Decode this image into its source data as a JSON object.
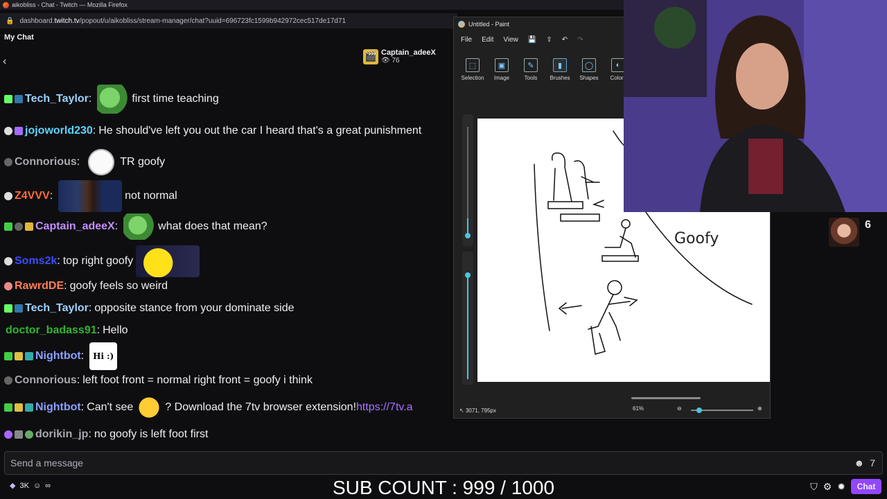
{
  "browser": {
    "title": "aikobliss - Chat - Twitch — Mozilla Firefox",
    "url_prefix": "dashboard.",
    "url_domain": "twitch.tv",
    "url_path": "/popout/u/aikobliss/stream-manager/chat?uuid=696723fc1599b942972cec517de17d71"
  },
  "chat": {
    "header": "My Chat",
    "pinned_user": "Captain_adeeX",
    "pinned_viewers": "76",
    "messages": [
      {
        "user": "Tech_Taylor",
        "color": "#9cd1ff",
        "text": "first time teaching",
        "emote": "pepe"
      },
      {
        "user": "jojoworld230",
        "color": "#5fd4ff",
        "text": "He should've left you out the car I heard that's a great punishment"
      },
      {
        "user": "Connorious",
        "color": "#a8a8b0",
        "text": "TR goofy",
        "emote": "troll"
      },
      {
        "user": "Z4VVV",
        "color": "#ff6a3d",
        "text": "not normal",
        "emote": "face"
      },
      {
        "user": "Captain_adeeX",
        "color": "#c48dff",
        "text": "what does that mean?",
        "emote": "pepe"
      },
      {
        "user": "Soms2k",
        "color": "#3a4dff",
        "text": "top right goofy",
        "emote": "yellow"
      },
      {
        "user": "RawrdDE",
        "color": "#ff7e55",
        "text": "goofy feels so weird"
      },
      {
        "user": "Tech_Taylor",
        "color": "#9cd1ff",
        "text": "opposite stance from your dominate side"
      },
      {
        "user": "doctor_badass91",
        "color": "#2fb52f",
        "text": "Hello"
      },
      {
        "user": "Nightbot",
        "color": "#8aa0ff",
        "text": "Hi :)",
        "emote": "hi"
      },
      {
        "user": "Connorious",
        "color": "#a8a8b0",
        "text": "left foot front = normal right front = goofy i think"
      },
      {
        "user": "Nightbot",
        "color": "#8aa0ff",
        "text": "Can't see",
        "text2": "? Download the 7tv browser extension!",
        "link": "https://7tv.a",
        "emote": "smirk"
      },
      {
        "user": "dorikin_jp",
        "color": "#a8a8b0",
        "text": "no goofy is left foot first"
      }
    ],
    "input_placeholder": "Send a message",
    "points": "3K",
    "sub_count": "SUB COUNT : 999 / 1000",
    "chat_button": "Chat"
  },
  "paint": {
    "title": "Untitled - Paint",
    "menu": [
      "File",
      "Edit",
      "View"
    ],
    "tools": [
      {
        "label": "Selection",
        "icon": "selection-icon",
        "glyph": "⬚"
      },
      {
        "label": "Image",
        "icon": "image-icon",
        "glyph": "▣"
      },
      {
        "label": "Tools",
        "icon": "tools-icon",
        "glyph": "✎"
      },
      {
        "label": "Brushes",
        "icon": "brush-icon",
        "glyph": "▮"
      },
      {
        "label": "Shapes",
        "icon": "shapes-icon",
        "glyph": "◯"
      },
      {
        "label": "Colors",
        "icon": "colors-icon",
        "glyph": "◐"
      }
    ],
    "canvas_text": "Goofy",
    "status_pos": "3071, 795px",
    "zoom": "61%"
  },
  "webcam": {
    "viewer_count": "6"
  },
  "colors": {
    "accent": "#9147ff",
    "background": "#0e0e10",
    "paint_bg": "#202020"
  }
}
